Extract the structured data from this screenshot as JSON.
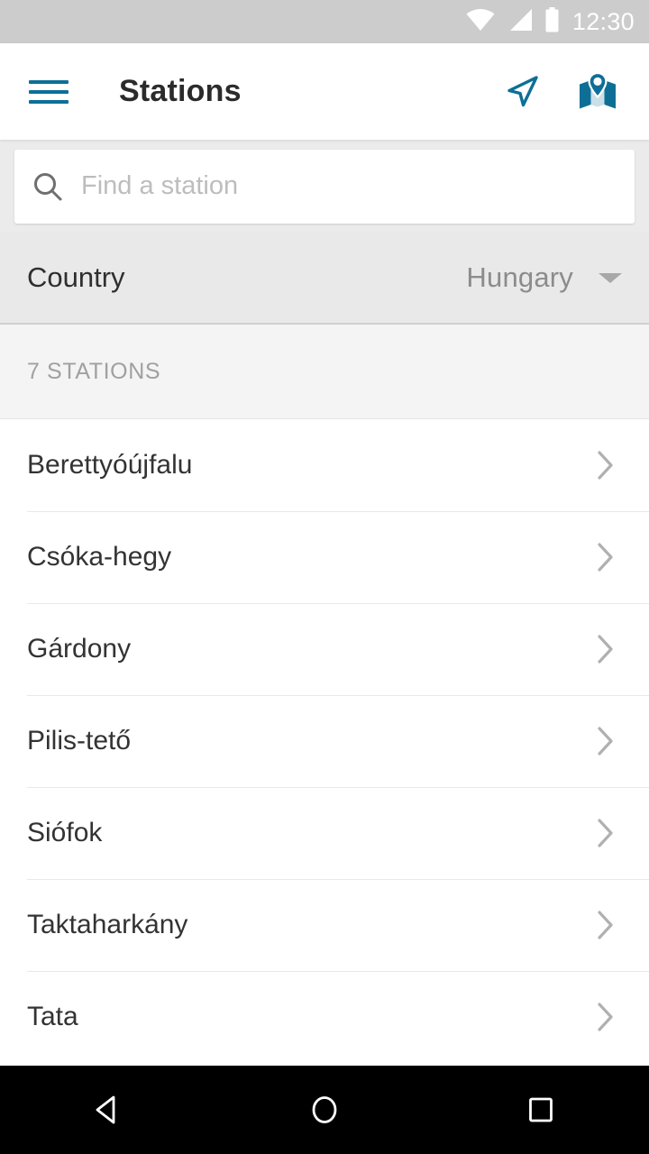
{
  "statusbar": {
    "time": "12:30",
    "icons": [
      "wifi-icon",
      "cell-signal-icon",
      "battery-icon"
    ],
    "bg_color": "#cccccc",
    "fg_color": "#ffffff"
  },
  "appbar": {
    "menu_icon": "hamburger-menu-icon",
    "title": "Stations",
    "actions": [
      {
        "icon": "navigation-arrow-icon"
      },
      {
        "icon": "map-pin-icon"
      }
    ],
    "accent_color": "#0d6f96",
    "title_color": "#2b2b2b"
  },
  "search": {
    "icon": "search-icon",
    "value": "",
    "placeholder": "Find a station"
  },
  "country_filter": {
    "label": "Country",
    "value": "Hungary",
    "caret_icon": "chevron-down-icon",
    "options": [
      "Hungary"
    ]
  },
  "section": {
    "header": "7 STATIONS",
    "count": 7
  },
  "stations": [
    {
      "name": "Berettyóújfalu",
      "chevron": "chevron-right-icon"
    },
    {
      "name": "Csóka-hegy",
      "chevron": "chevron-right-icon"
    },
    {
      "name": "Gárdony",
      "chevron": "chevron-right-icon"
    },
    {
      "name": "Pilis-tető",
      "chevron": "chevron-right-icon"
    },
    {
      "name": "Siófok",
      "chevron": "chevron-right-icon"
    },
    {
      "name": "Taktaharkány",
      "chevron": "chevron-right-icon"
    },
    {
      "name": "Tata",
      "chevron": "chevron-right-icon"
    }
  ],
  "navbar": {
    "buttons": [
      {
        "icon": "back-triangle-icon"
      },
      {
        "icon": "home-circle-icon"
      },
      {
        "icon": "recents-square-icon"
      }
    ],
    "bg_color": "#000000"
  }
}
